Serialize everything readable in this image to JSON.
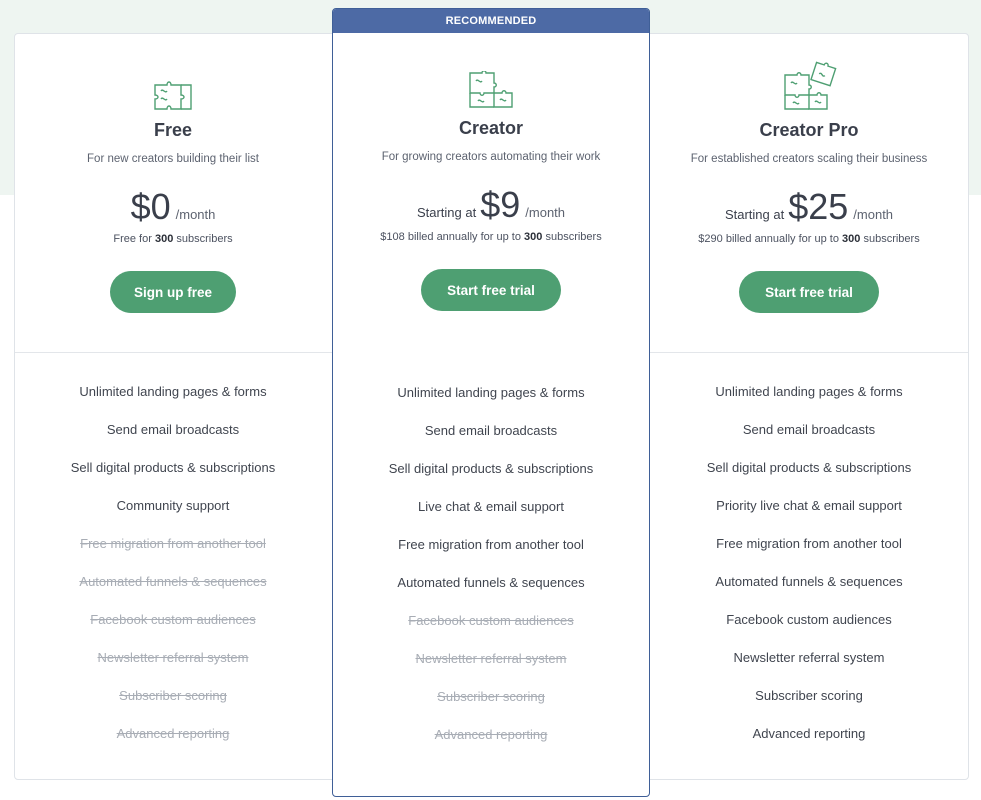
{
  "plans": [
    {
      "name": "Free",
      "description": "For new creators building their list",
      "price_prefix": "",
      "price": "$0",
      "period": "/month",
      "billing_pre": "Free for",
      "billing_count": "300",
      "billing_post": "subscribers",
      "cta": "Sign up free",
      "icon": "puzzle-one-icon",
      "features": [
        {
          "label": "Unlimited landing pages & forms",
          "included": true
        },
        {
          "label": "Send email broadcasts",
          "included": true
        },
        {
          "label": "Sell digital products & subscriptions",
          "included": true
        },
        {
          "label": "Community support",
          "included": true
        },
        {
          "label": "Free migration from another tool",
          "included": false
        },
        {
          "label": "Automated funnels & sequences",
          "included": false
        },
        {
          "label": "Facebook custom audiences",
          "included": false
        },
        {
          "label": "Newsletter referral system",
          "included": false
        },
        {
          "label": "Subscriber scoring",
          "included": false
        },
        {
          "label": "Advanced reporting",
          "included": false
        }
      ]
    },
    {
      "badge": "RECOMMENDED",
      "name": "Creator",
      "description": "For growing creators automating their work",
      "price_prefix": "Starting at",
      "price": "$9",
      "period": "/month",
      "billing_pre": "$108 billed annually for up to",
      "billing_count": "300",
      "billing_post": "subscribers",
      "cta": "Start free trial",
      "icon": "puzzle-two-icon",
      "features": [
        {
          "label": "Unlimited landing pages & forms",
          "included": true
        },
        {
          "label": "Send email broadcasts",
          "included": true
        },
        {
          "label": "Sell digital products & subscriptions",
          "included": true
        },
        {
          "label": "Live chat & email support",
          "included": true
        },
        {
          "label": "Free migration from another tool",
          "included": true
        },
        {
          "label": "Automated funnels & sequences",
          "included": true
        },
        {
          "label": "Facebook custom audiences",
          "included": false
        },
        {
          "label": "Newsletter referral system",
          "included": false
        },
        {
          "label": "Subscriber scoring",
          "included": false
        },
        {
          "label": "Advanced reporting",
          "included": false
        }
      ]
    },
    {
      "name": "Creator Pro",
      "description": "For established creators scaling their business",
      "price_prefix": "Starting at",
      "price": "$25",
      "period": "/month",
      "billing_pre": "$290 billed annually for up to",
      "billing_count": "300",
      "billing_post": "subscribers",
      "cta": "Start free trial",
      "icon": "puzzle-three-icon",
      "features": [
        {
          "label": "Unlimited landing pages & forms",
          "included": true
        },
        {
          "label": "Send email broadcasts",
          "included": true
        },
        {
          "label": "Sell digital products & subscriptions",
          "included": true
        },
        {
          "label": "Priority live chat & email support",
          "included": true
        },
        {
          "label": "Free migration from another tool",
          "included": true
        },
        {
          "label": "Automated funnels & sequences",
          "included": true
        },
        {
          "label": "Facebook custom audiences",
          "included": true
        },
        {
          "label": "Newsletter referral system",
          "included": true
        },
        {
          "label": "Subscriber scoring",
          "included": true
        },
        {
          "label": "Advanced reporting",
          "included": true
        }
      ]
    }
  ],
  "colors": {
    "accent_green": "#4e9f72",
    "recommended_blue": "#4d6aa5",
    "background_band": "#eef5f1"
  }
}
